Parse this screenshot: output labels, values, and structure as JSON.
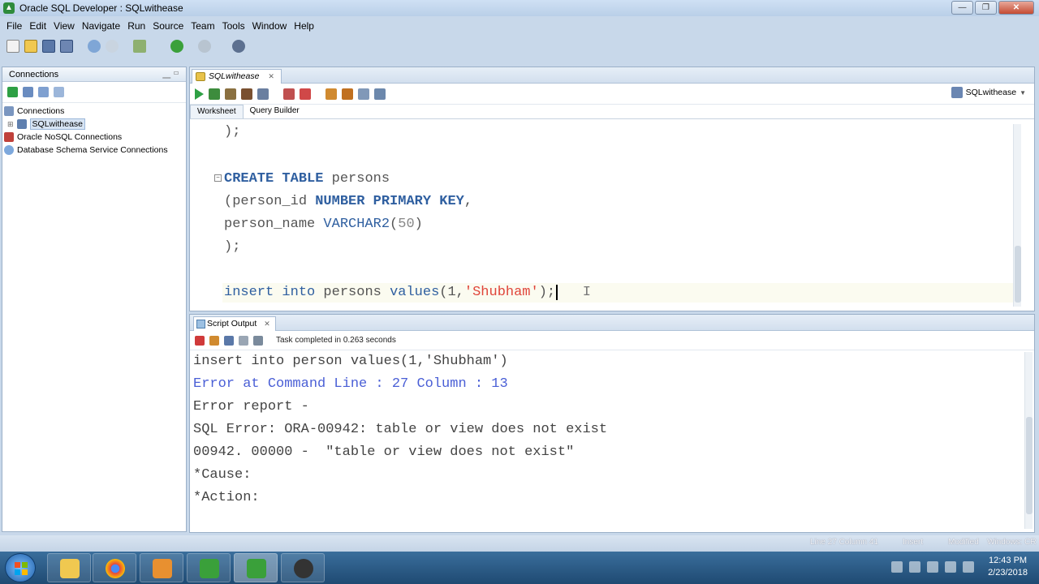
{
  "window": {
    "title": "Oracle SQL Developer : SQLwithease",
    "minimize": "—",
    "maximize": "❐",
    "close": "✕"
  },
  "menu": [
    "File",
    "Edit",
    "View",
    "Navigate",
    "Run",
    "Source",
    "Team",
    "Tools",
    "Window",
    "Help"
  ],
  "connections_panel": {
    "title": "Connections",
    "tree": [
      {
        "label": "Connections"
      },
      {
        "label": "SQLwithease"
      },
      {
        "label": "Oracle NoSQL Connections"
      },
      {
        "label": "Database Schema Service Connections"
      }
    ]
  },
  "editor": {
    "tab_label": "SQLwithease",
    "connection_selector": "SQLwithease",
    "subtabs": [
      "Worksheet",
      "Query Builder"
    ]
  },
  "script_output": {
    "tab_label": "Script Output",
    "status": "Task completed in 0.263 seconds",
    "lines": [
      "insert into person values(1,'Shubham')",
      "Error at Command Line : 27 Column : 13",
      "Error report -",
      "SQL Error: ORA-00942: table or view does not exist",
      "00942. 00000 -  \"table or view does not exist\"",
      "*Cause:",
      "*Action:"
    ]
  },
  "statusbar": {
    "position": "Line 27 Column 41",
    "mode": "Insert",
    "modified": "Modified",
    "encoding": "Windows: CR"
  },
  "taskbar": {
    "time": "12:43 PM",
    "date": "2/23/2018"
  },
  "colors": {
    "keyword": "#2f5fa0",
    "string": "#e0453a",
    "error": "#4a5fd6"
  }
}
